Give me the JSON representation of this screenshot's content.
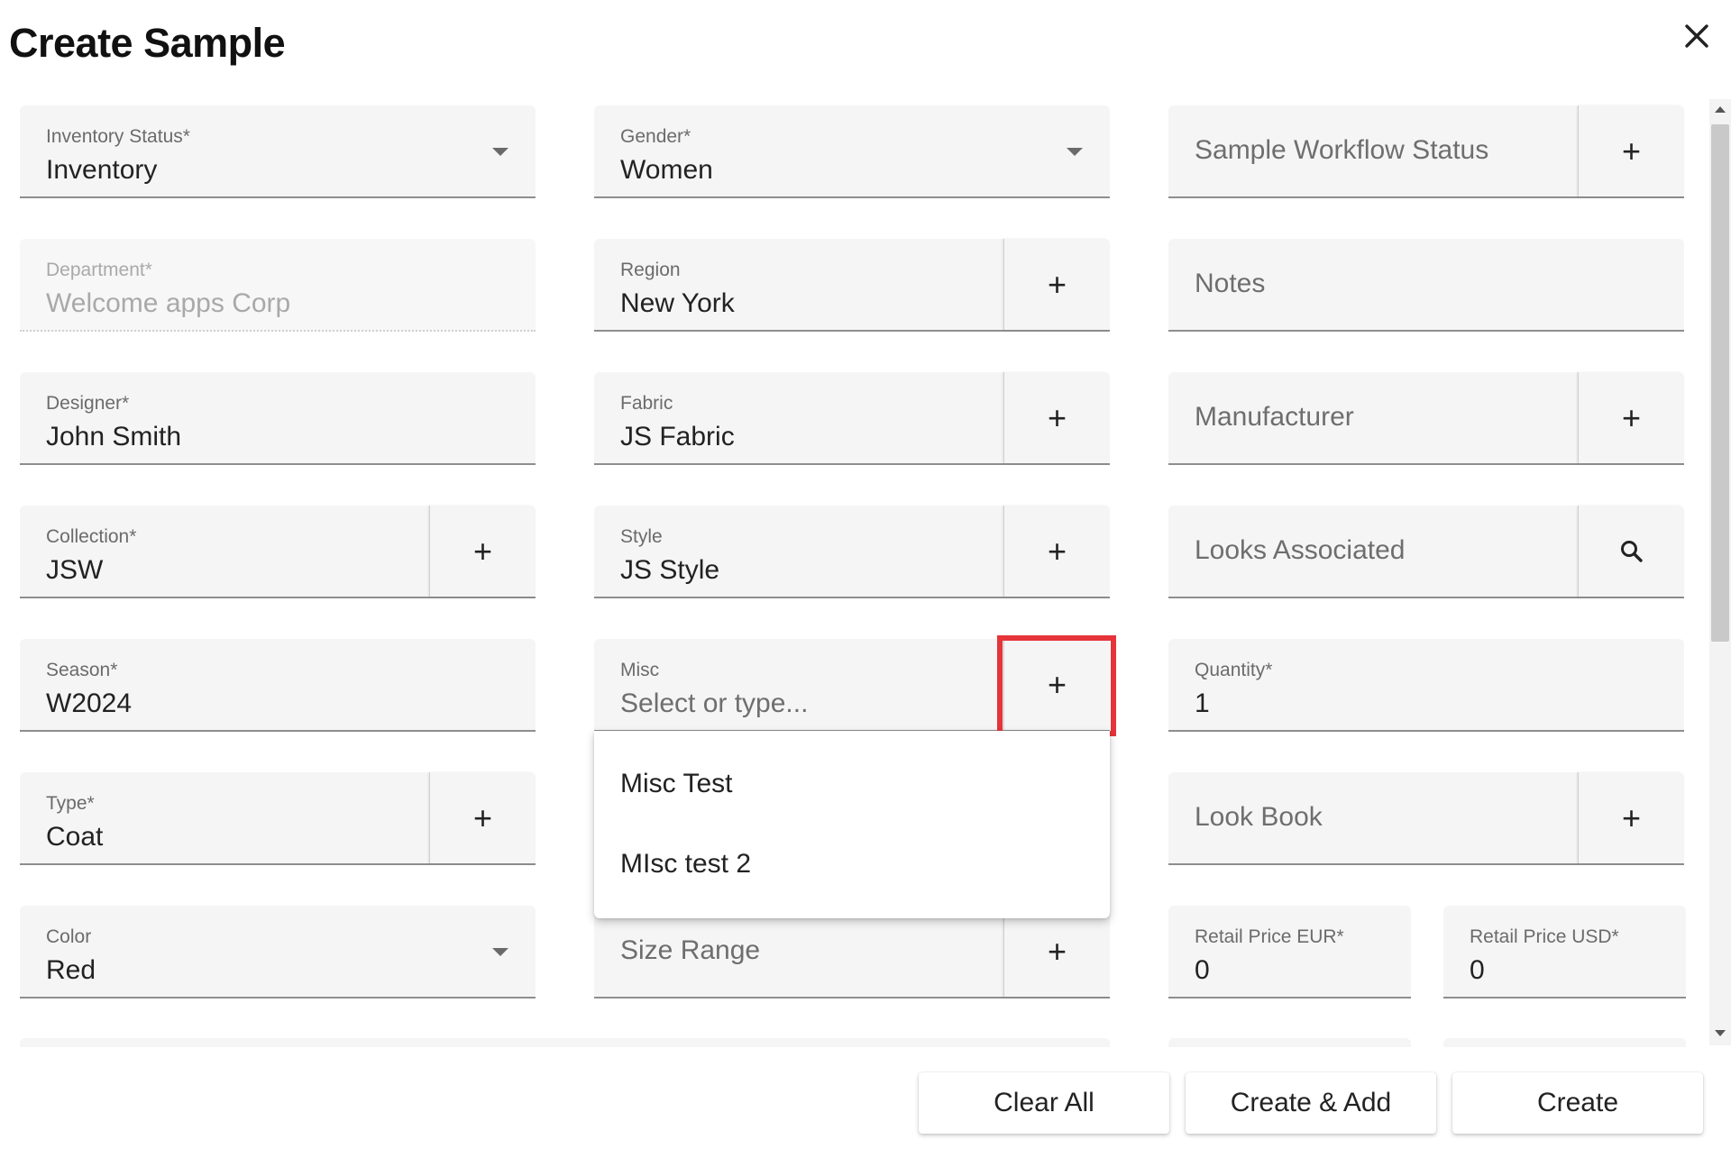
{
  "dialog": {
    "title": "Create Sample",
    "close_icon": "close-icon"
  },
  "fields": {
    "inventory_status": {
      "label": "Inventory Status*",
      "value": "Inventory"
    },
    "gender": {
      "label": "Gender*",
      "value": "Women"
    },
    "sample_workflow_status": {
      "placeholder": "Sample Workflow Status"
    },
    "department": {
      "label": "Department*",
      "value": "Welcome apps Corp"
    },
    "region": {
      "label": "Region",
      "value": "New York"
    },
    "notes": {
      "placeholder": "Notes"
    },
    "designer": {
      "label": "Designer*",
      "value": "John Smith"
    },
    "fabric": {
      "label": "Fabric",
      "value": "JS Fabric"
    },
    "manufacturer": {
      "placeholder": "Manufacturer"
    },
    "collection": {
      "label": "Collection*",
      "value": "JSW"
    },
    "style": {
      "label": "Style",
      "value": "JS Style"
    },
    "looks_associated": {
      "placeholder": "Looks Associated"
    },
    "season": {
      "label": "Season*",
      "value": "W2024"
    },
    "misc": {
      "label": "Misc",
      "placeholder": "Select or type..."
    },
    "quantity": {
      "label": "Quantity*",
      "value": "1"
    },
    "type": {
      "label": "Type*",
      "value": "Coat"
    },
    "look_book": {
      "placeholder": "Look Book"
    },
    "color": {
      "label": "Color",
      "value": "Red"
    },
    "size_range": {
      "placeholder": "Size Range"
    },
    "retail_price_eur": {
      "label": "Retail Price EUR*",
      "value": "0"
    },
    "retail_price_usd": {
      "label": "Retail Price USD*",
      "value": "0"
    }
  },
  "add_symbol": "+",
  "misc_dropdown": {
    "options": [
      "Misc Test",
      "MIsc test 2"
    ]
  },
  "footer": {
    "clear_all": "Clear All",
    "create_add": "Create & Add",
    "create": "Create"
  },
  "colors": {
    "highlight": "#e5343a",
    "field_bg": "#f5f5f5"
  }
}
